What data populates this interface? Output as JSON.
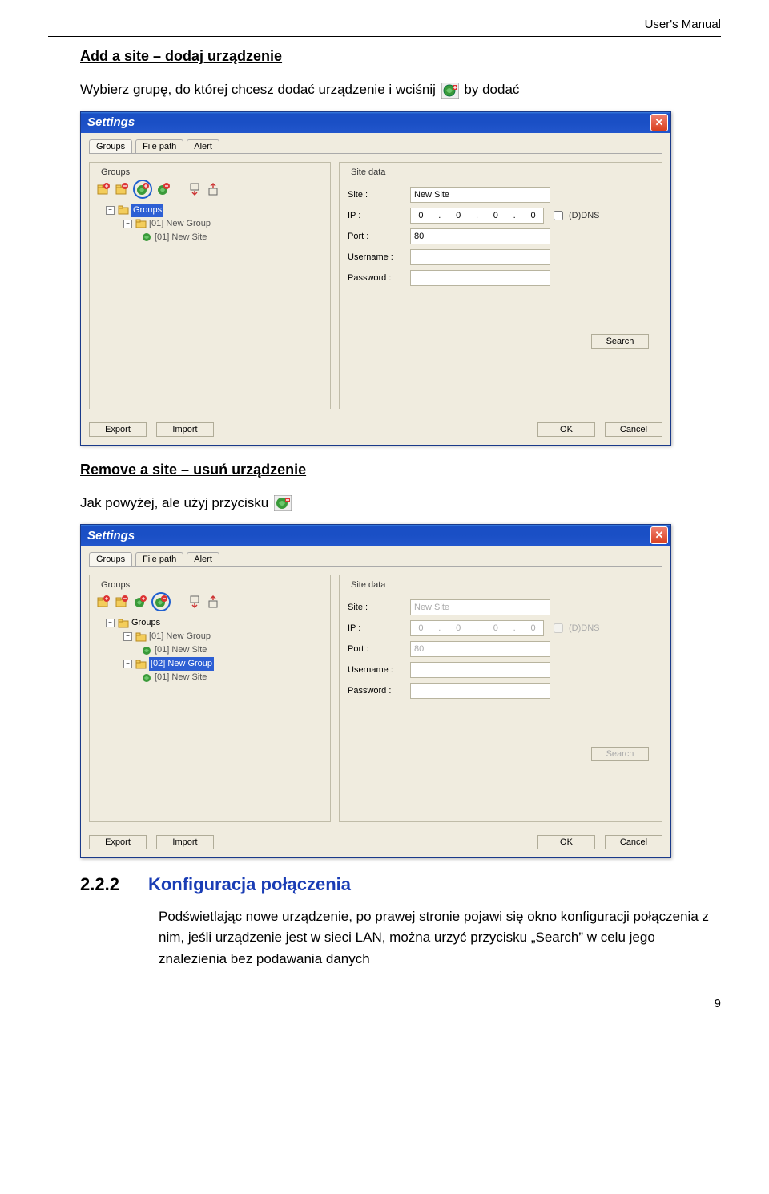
{
  "header": {
    "manual_label": "User's Manual"
  },
  "section_add": {
    "heading": "Add a site – dodaj urządzenie",
    "text_before_icon": "Wybierz grupę, do której chcesz dodać urządzenie i wciśnij ",
    "text_after_icon": " by dodać"
  },
  "section_remove": {
    "heading": "Remove a site – usuń urządzenie",
    "text": "Jak powyżej, ale użyj przycisku "
  },
  "section_conf": {
    "number": "2.2.2",
    "title": "Konfiguracja połączenia",
    "paragraph": "Podświetlając nowe urządzenie, po prawej stronie pojawi się okno konfiguracji połączenia z nim, jeśli urządzenie jest w sieci LAN, można urzyć przycisku „Search” w celu jego znalezienia bez podawania danych"
  },
  "window": {
    "title": "Settings",
    "tabs": {
      "groups": "Groups",
      "file_path": "File path",
      "alert": "Alert"
    },
    "groups_label": "Groups",
    "site_data_label": "Site data",
    "fields": {
      "site_label": "Site :",
      "ip_label": "IP :",
      "port_label": "Port :",
      "user_label": "Username :",
      "pass_label": "Password :",
      "ddns_label": "(D)DNS"
    },
    "buttons": {
      "search": "Search",
      "export": "Export",
      "import": "Import",
      "ok": "OK",
      "cancel": "Cancel"
    }
  },
  "window1_data": {
    "tree": {
      "root": "Groups",
      "g1": "[01] New Group",
      "s1": "[01] New Site"
    },
    "site_value": "New Site",
    "ip": {
      "a": "0",
      "b": "0",
      "c": "0",
      "d": "0"
    },
    "port_value": "80"
  },
  "window2_data": {
    "tree": {
      "root": "Groups",
      "g1": "[01] New Group",
      "s1": "[01] New Site",
      "g2": "[02] New Group",
      "s2": "[01] New Site"
    },
    "site_value": "New Site",
    "ip": {
      "a": "0",
      "b": "0",
      "c": "0",
      "d": "0"
    },
    "port_value": "80"
  },
  "footer": {
    "page": "9"
  }
}
